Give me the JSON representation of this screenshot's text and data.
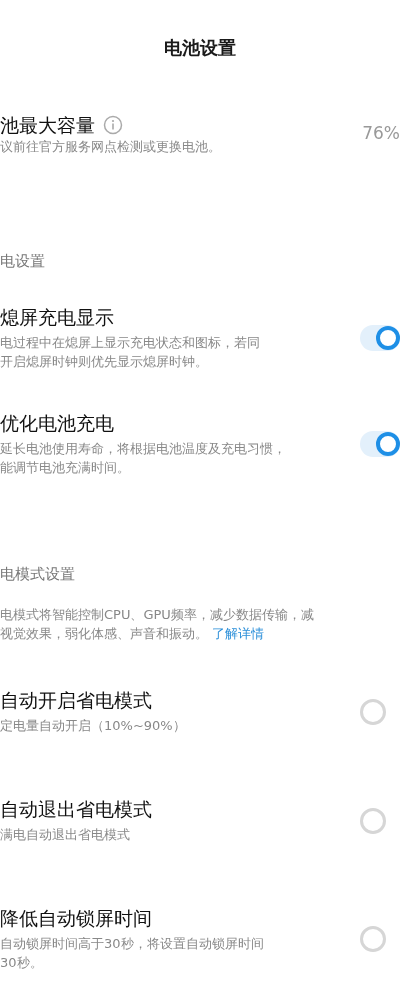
{
  "title": "电池设置",
  "capacity": {
    "label": "池最大容量",
    "description": "议前往官方服务网点检测或更换电池。",
    "value": "76%"
  },
  "sections": [
    {
      "header": "电设置",
      "items": [
        {
          "kind": "toggle",
          "title": "熄屏充电显示",
          "description": [
            "电过程中在熄屏上显示充电状态和图标，若同",
            "开启熄屏时钟则优先显示熄屏时钟。"
          ],
          "on": true
        },
        {
          "kind": "toggle",
          "title": "优化电池充电",
          "description": [
            "延长电池使用寿命，将根据电池温度及充电习惯，",
            "能调节电池充满时间。"
          ],
          "on": true
        }
      ]
    },
    {
      "header": "电模式设置",
      "note": [
        "电模式将智能控制CPU、GPU频率，减少数据传输，减",
        "视觉效果，弱化体感、声音和振动。"
      ],
      "link": "了解详情",
      "items": [
        {
          "kind": "radio",
          "title": "自动开启省电模式",
          "description": [
            "定电量自动开启（10%~90%）"
          ],
          "selected": false
        },
        {
          "kind": "radio",
          "title": "自动退出省电模式",
          "description": [
            "满电自动退出省电模式"
          ],
          "selected": false
        },
        {
          "kind": "radio",
          "title": "降低自动锁屏时间",
          "description": [
            "自动锁屏时间高于30秒，将设置自动锁屏时间",
            "30秒。"
          ],
          "selected": false
        }
      ]
    }
  ]
}
